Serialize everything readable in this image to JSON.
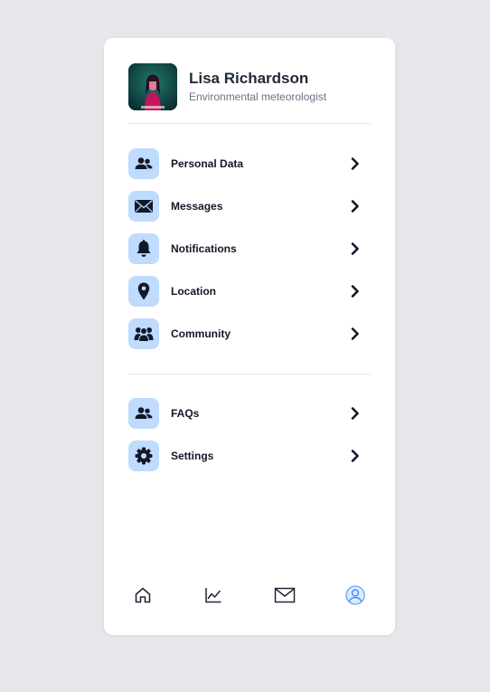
{
  "profile": {
    "name": "Lisa Richardson",
    "role": "Environmental meteorologist"
  },
  "menu_primary": [
    {
      "label": "Personal Data",
      "icon": "users-icon"
    },
    {
      "label": "Messages",
      "icon": "envelope-icon"
    },
    {
      "label": "Notifications",
      "icon": "bell-icon"
    },
    {
      "label": "Location",
      "icon": "map-pin-icon"
    },
    {
      "label": "Community",
      "icon": "community-icon"
    }
  ],
  "menu_secondary": [
    {
      "label": "FAQs",
      "icon": "users-icon"
    },
    {
      "label": "Settings",
      "icon": "gear-icon"
    }
  ],
  "bottom_nav": [
    {
      "icon": "home-icon"
    },
    {
      "icon": "chart-icon"
    },
    {
      "icon": "mail-icon"
    },
    {
      "icon": "profile-icon",
      "active": true
    }
  ],
  "colors": {
    "page_background": "#e5e7eb",
    "card_background": "#ffffff",
    "icon_box": "#bfdbfe",
    "text_primary": "#111827",
    "text_secondary": "#6b7280"
  }
}
